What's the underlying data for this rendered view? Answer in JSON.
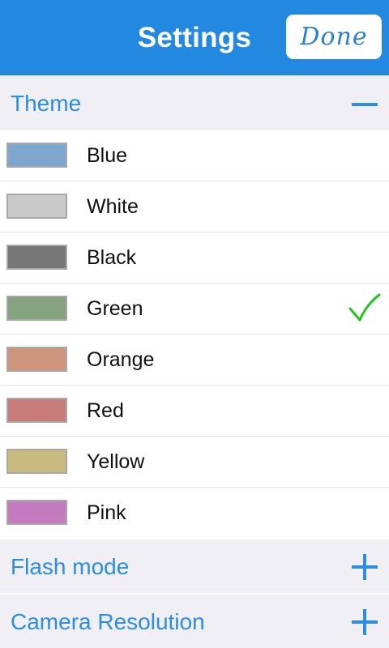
{
  "header": {
    "title": "Settings",
    "done_label": "Done"
  },
  "colors": {
    "header_bg": "#2389e0",
    "accent": "#2b8de3",
    "section_bg": "#efeff4",
    "check": "#22c31f"
  },
  "sections": {
    "theme": {
      "label": "Theme",
      "state": "expanded",
      "icon": "minus-icon"
    },
    "flash_mode": {
      "label": "Flash mode",
      "state": "collapsed",
      "icon": "plus-icon"
    },
    "camera_resolution": {
      "label": "Camera Resolution",
      "state": "collapsed",
      "icon": "plus-icon"
    }
  },
  "themes": [
    {
      "name": "Blue",
      "color": "#7fa6cc",
      "selected": false
    },
    {
      "name": "White",
      "color": "#c9c9c9",
      "selected": false
    },
    {
      "name": "Black",
      "color": "#777777",
      "selected": false
    },
    {
      "name": "Green",
      "color": "#86a47f",
      "selected": true
    },
    {
      "name": "Orange",
      "color": "#cc957c",
      "selected": false
    },
    {
      "name": "Red",
      "color": "#c87b7b",
      "selected": false
    },
    {
      "name": "Yellow",
      "color": "#c8bb7f",
      "selected": false
    },
    {
      "name": "Pink",
      "color": "#c47cbe",
      "selected": false
    }
  ]
}
